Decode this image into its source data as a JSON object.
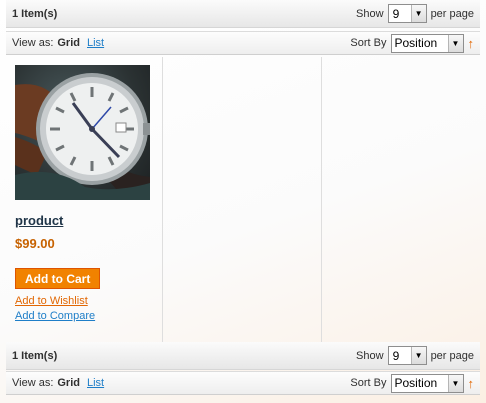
{
  "top_toolbar": {
    "amount": "1 Item(s)",
    "show_label": "Show",
    "limit_value": "9",
    "per_page_label": "per page",
    "view_as_label": "View as:",
    "mode_grid": "Grid",
    "mode_list": "List",
    "sort_by_label": "Sort By",
    "sort_value": "Position",
    "sort_arrow": "↑"
  },
  "product": {
    "name": "product",
    "price": "$99.00",
    "add_to_cart": "Add to Cart",
    "add_to_wishlist": "Add to Wishlist",
    "add_to_compare": "Add to Compare",
    "image_icon": "wristwatch-image"
  },
  "bottom_toolbar": {
    "amount": "1 Item(s)",
    "show_label": "Show",
    "limit_value": "9",
    "per_page_label": "per page",
    "view_as_label": "View as:",
    "mode_grid": "Grid",
    "mode_list": "List",
    "sort_by_label": "Sort By",
    "sort_value": "Position",
    "sort_arrow": "↑"
  },
  "colors": {
    "accent_orange": "#f18200",
    "price_orange": "#c76200",
    "link_blue": "#1e7ec8"
  }
}
